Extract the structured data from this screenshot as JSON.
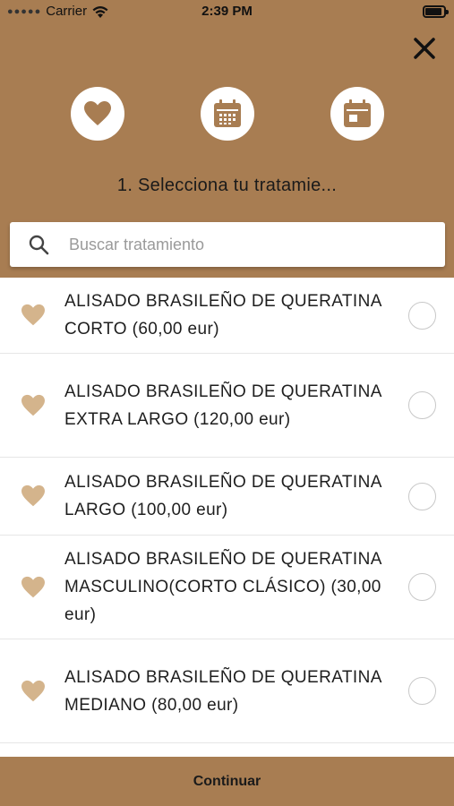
{
  "status_bar": {
    "carrier": "Carrier",
    "time": "2:39 PM"
  },
  "header": {
    "close_icon": "close-icon",
    "steps": [
      {
        "icon": "heart-icon"
      },
      {
        "icon": "calendar-grid-icon"
      },
      {
        "icon": "calendar-day-icon"
      }
    ],
    "step_title": "1. Selecciona tu tratamie..."
  },
  "search": {
    "placeholder": "Buscar tratamiento",
    "value": ""
  },
  "treatments": [
    {
      "label": "ALISADO BRASILEÑO DE QUERATINA CORTO (60,00 eur)",
      "selected": false
    },
    {
      "label": "ALISADO BRASILEÑO DE QUERATINA EXTRA LARGO (120,00 eur)",
      "selected": false
    },
    {
      "label": "ALISADO BRASILEÑO DE QUERATINA LARGO (100,00 eur)",
      "selected": false
    },
    {
      "label": "ALISADO BRASILEÑO DE QUERATINA MASCULINO(CORTO CLÁSICO) (30,00 eur)",
      "selected": false
    },
    {
      "label": "ALISADO BRASILEÑO DE QUERATINA MEDIANO (80,00 eur)",
      "selected": false
    }
  ],
  "footer": {
    "continue_label": "Continuar"
  },
  "colors": {
    "brand": "#a87d52",
    "heart": "#d4b48c"
  }
}
